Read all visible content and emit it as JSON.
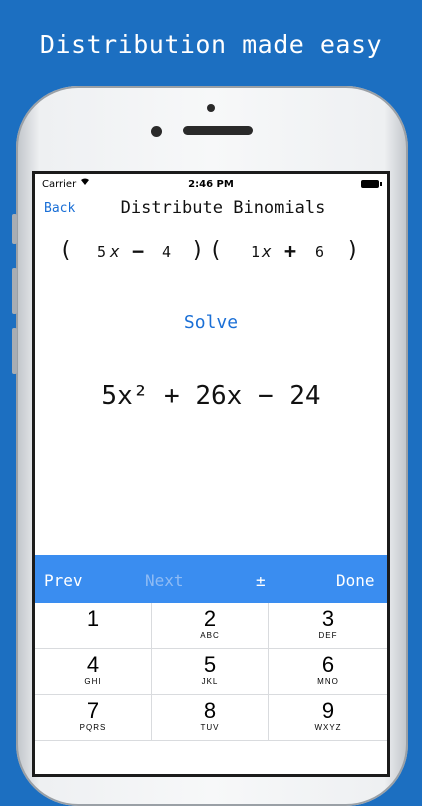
{
  "headline": "Distribution made easy",
  "status": {
    "carrier": "Carrier",
    "time": "2:46 PM"
  },
  "nav": {
    "back": "Back",
    "title": "Distribute Binomials"
  },
  "equation": {
    "open1": "(",
    "a": "5",
    "x1": "x",
    "op1": "−",
    "b": "4",
    "close1": ")",
    "open2": "(",
    "c": "1",
    "x2": "x",
    "op2": "+",
    "d": "6",
    "close2": ")"
  },
  "solve_label": "Solve",
  "result": "5x² + 26x − 24",
  "toolbar": {
    "prev": "Prev",
    "next": "Next",
    "sign": "±",
    "done": "Done"
  },
  "keys": [
    {
      "digit": "1",
      "letters": ""
    },
    {
      "digit": "2",
      "letters": "ABC"
    },
    {
      "digit": "3",
      "letters": "DEF"
    },
    {
      "digit": "4",
      "letters": "GHI"
    },
    {
      "digit": "5",
      "letters": "JKL"
    },
    {
      "digit": "6",
      "letters": "MNO"
    },
    {
      "digit": "7",
      "letters": "PQRS"
    },
    {
      "digit": "8",
      "letters": "TUV"
    },
    {
      "digit": "9",
      "letters": "WXYZ"
    }
  ],
  "colors": {
    "background": "#1c6fc1",
    "accent": "#1a6fd6",
    "toolbar": "#3a8df0"
  }
}
